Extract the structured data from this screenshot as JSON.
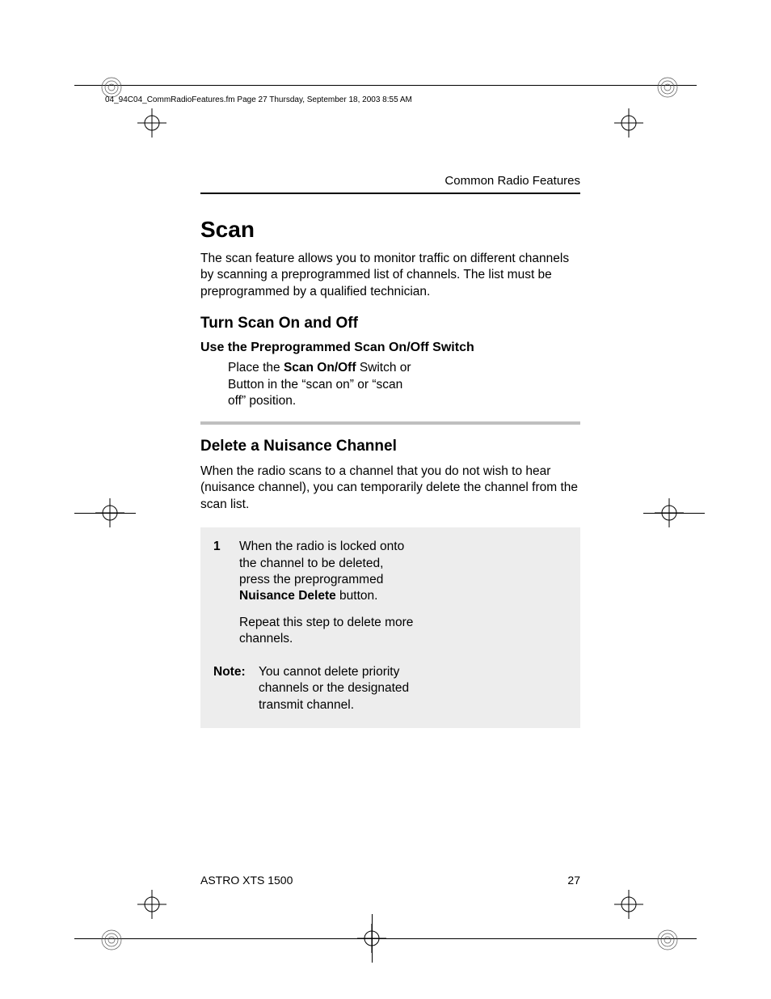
{
  "header_line": "04_94C04_CommRadioFeatures.fm  Page 27  Thursday, September 18, 2003  8:55 AM",
  "running_head": "Common Radio Features",
  "h1": "Scan",
  "intro": "The scan feature allows you to monitor traffic on different channels by scanning a preprogrammed list of channels. The list must be preprogrammed by a qualified technician.",
  "h2_turn": "Turn Scan On and Off",
  "h3_use": "Use the Preprogrammed Scan On/Off Switch",
  "turn_body_pre": "Place the ",
  "turn_body_bold": "Scan On/Off",
  "turn_body_post": " Switch or Button in the “scan on” or “scan off” position.",
  "h2_delete": "Delete a Nuisance Channel",
  "delete_intro": "When the radio scans to a channel that you do not wish to hear (nuisance channel), you can temporarily delete the channel from the scan list.",
  "step_num": "1",
  "step_p1_pre": "When the radio is locked onto the channel to be deleted, press the preprogrammed ",
  "step_p1_bold": "Nuisance Delete",
  "step_p1_post": " button.",
  "step_p2": "Repeat this step to delete more channels.",
  "note_label": "Note:",
  "note_text": "You cannot delete priority channels or the designated transmit channel.",
  "footer_left": "ASTRO XTS 1500",
  "footer_right": "27"
}
